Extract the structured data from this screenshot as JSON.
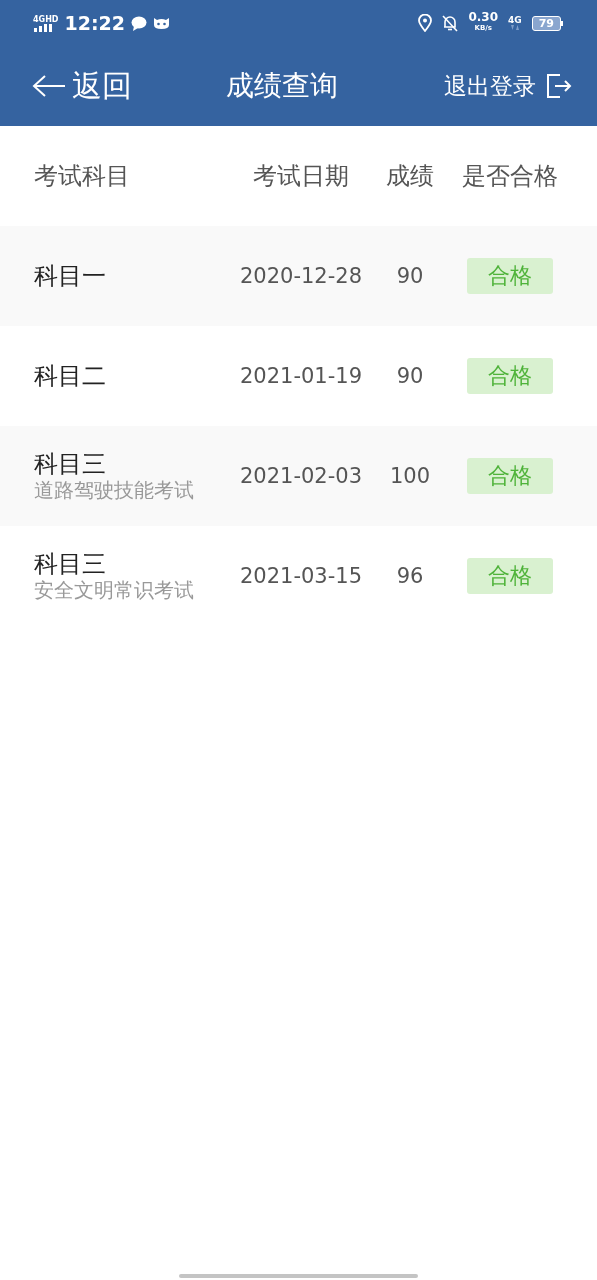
{
  "status_bar": {
    "network": "4G",
    "hd": "HD",
    "time": "12:22",
    "speed": "0.30",
    "speed_unit": "KB/s",
    "mobile": "4G",
    "battery": "79"
  },
  "nav": {
    "back": "返回",
    "title": "成绩查询",
    "logout": "退出登录"
  },
  "table": {
    "columns": [
      "考试科目",
      "考试日期",
      "成绩",
      "是否合格"
    ],
    "rows": [
      {
        "subject": "科目一",
        "date": "2020-12-28",
        "score": "90",
        "result": {
          "label": "合格",
          "passed": true
        }
      },
      {
        "subject": "科目二",
        "date": "2021-01-19",
        "score": "90",
        "result": {
          "label": "合格",
          "passed": true
        }
      },
      {
        "subject": "科目三",
        "subtitle": "道路驾驶技能考试",
        "date": "2021-02-03",
        "score": "100",
        "result": {
          "label": "合格",
          "passed": true
        }
      },
      {
        "subject": "科目三",
        "subtitle": "安全文明常识考试",
        "date": "2021-03-15",
        "score": "96",
        "result": {
          "label": "合格",
          "passed": true
        }
      }
    ]
  }
}
